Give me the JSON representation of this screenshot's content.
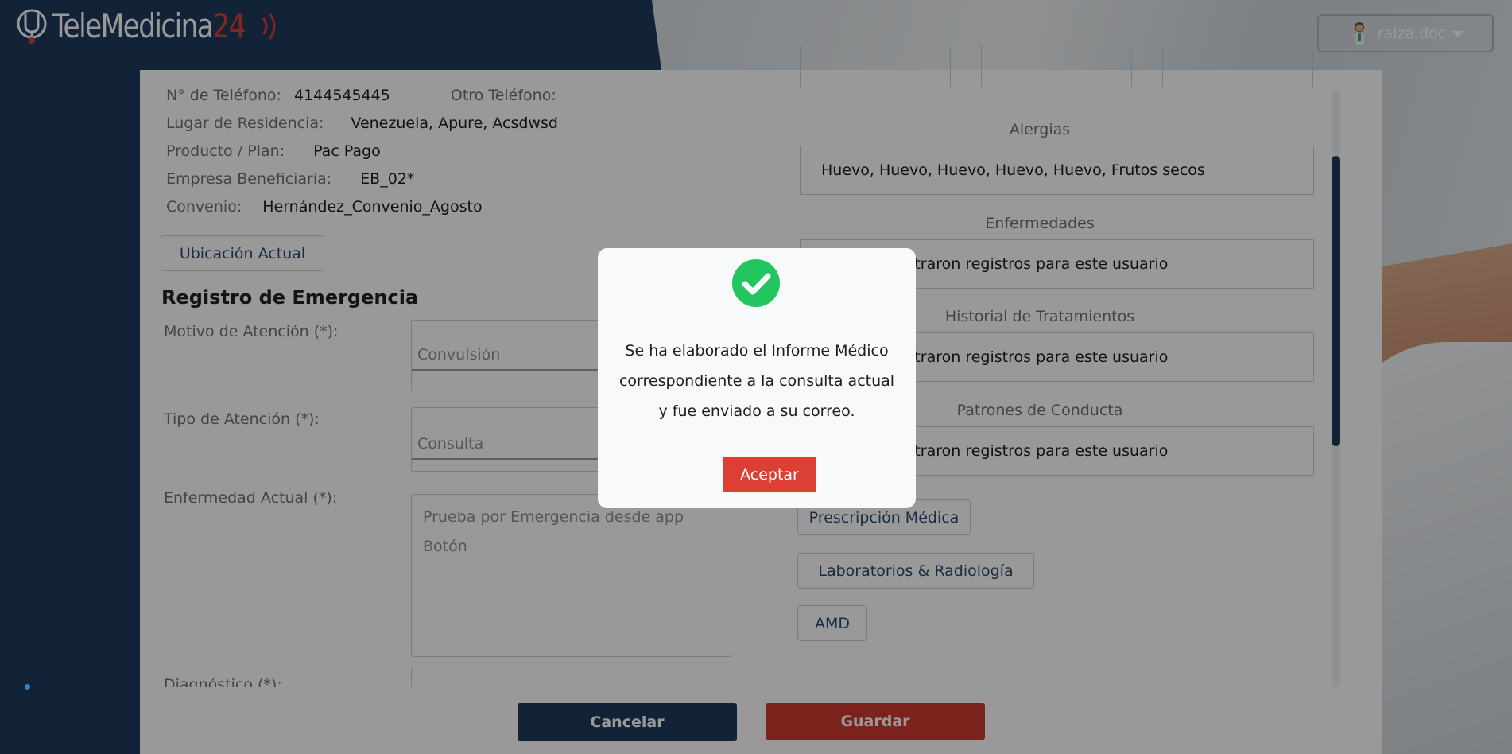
{
  "header": {
    "logo_text": "TeleMedicina",
    "logo_number": "24",
    "username": "raiza.doc"
  },
  "patient_info": {
    "phone_label": "N° de Teléfono:",
    "phone_value": "4144545445",
    "other_phone_label": "Otro Teléfono:",
    "residence_label": "Lugar de Residencia:",
    "residence_value": "Venezuela, Apure, Acsdwsd",
    "plan_label": "Producto / Plan:",
    "plan_value": "Pac Pago",
    "company_label": "Empresa Beneficiaria:",
    "company_value": "EB_02*",
    "agreement_label": "Convenio:",
    "agreement_value": "Hernández_Convenio_Agosto"
  },
  "location_button": "Ubicación Actual",
  "emergency": {
    "title": "Registro de Emergencia",
    "reason_label": "Motivo de Atención (*):",
    "reason_value": "Convulsión",
    "type_label": "Tipo de Atención (*):",
    "type_value": "Consulta",
    "illness_label": "Enfermedad Actual (*):",
    "illness_value": "Prueba por Emergencia desde app Botón",
    "diagnosis_label": "Diagnóstico (*):"
  },
  "history": {
    "allergies_title": "Alergias",
    "allergies_value": "Huevo, Huevo, Huevo, Huevo, Huevo, Frutos secos",
    "diseases_title": "Enfermedades",
    "diseases_value": "No se encontraron registros para este usuario",
    "treatments_title": "Historial de Tratamientos",
    "treatments_value": "No se encontraron registros para este usuario",
    "behavior_title": "Patrones de Conducta",
    "behavior_value": "No se encontraron registros para este usuario"
  },
  "actions": {
    "prescription": "Prescripción Médica",
    "labs": "Laboratorios & Radiología",
    "amd": "AMD",
    "cancel": "Cancelar",
    "save": "Guardar"
  },
  "modal": {
    "message": "Se ha elaborado el Informe Médico correspondiente a la consulta actual y fue enviado a su correo.",
    "accept": "Aceptar",
    "icon": "check-circle-icon",
    "icon_color": "#22c55e"
  },
  "colors": {
    "primary": "#1f3b5c",
    "danger": "#cf3a2f",
    "success": "#22c55e"
  }
}
